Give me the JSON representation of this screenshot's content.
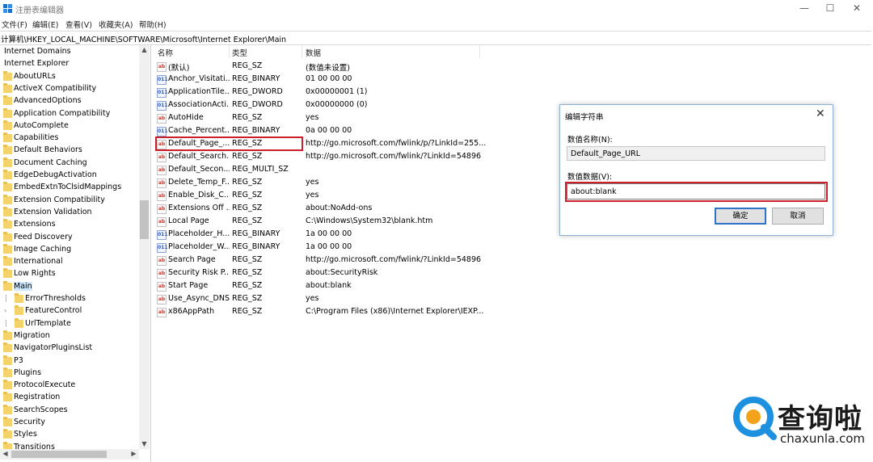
{
  "window": {
    "title": "注册表编辑器",
    "controls": {
      "minimize": "—",
      "maximize": "☐",
      "close": "✕"
    }
  },
  "menu": [
    "文件(F)",
    "编辑(E)",
    "查看(V)",
    "收藏夹(A)",
    "帮助(H)"
  ],
  "address": "计算机\\HKEY_LOCAL_MACHINE\\SOFTWARE\\Microsoft\\Internet Explorer\\Main",
  "tree": {
    "items": [
      {
        "label": "Internet Domains",
        "level": 0,
        "folder": false
      },
      {
        "label": "Internet Explorer",
        "level": 0,
        "folder": false
      },
      {
        "label": "AboutURLs",
        "level": 1,
        "folder": true
      },
      {
        "label": "ActiveX Compatibility",
        "level": 1,
        "folder": true
      },
      {
        "label": "AdvancedOptions",
        "level": 1,
        "folder": true
      },
      {
        "label": "Application Compatibility",
        "level": 1,
        "folder": true
      },
      {
        "label": "AutoComplete",
        "level": 1,
        "folder": true
      },
      {
        "label": "Capabilities",
        "level": 1,
        "folder": true
      },
      {
        "label": "Default Behaviors",
        "level": 1,
        "folder": true
      },
      {
        "label": "Document Caching",
        "level": 1,
        "folder": true
      },
      {
        "label": "EdgeDebugActivation",
        "level": 1,
        "folder": true
      },
      {
        "label": "EmbedExtnToClsidMappings",
        "level": 1,
        "folder": true
      },
      {
        "label": "Extension Compatibility",
        "level": 1,
        "folder": true
      },
      {
        "label": "Extension Validation",
        "level": 1,
        "folder": true
      },
      {
        "label": "Extensions",
        "level": 1,
        "folder": true
      },
      {
        "label": "Feed Discovery",
        "level": 1,
        "folder": true
      },
      {
        "label": "Image Caching",
        "level": 1,
        "folder": true
      },
      {
        "label": "International",
        "level": 1,
        "folder": true
      },
      {
        "label": "Low Rights",
        "level": 1,
        "folder": true
      },
      {
        "label": "Main",
        "level": 1,
        "folder": true,
        "selected": true
      },
      {
        "label": "ErrorThresholds",
        "level": 2,
        "folder": true
      },
      {
        "label": "FeatureControl",
        "level": 2,
        "folder": true,
        "expandable": true
      },
      {
        "label": "UrlTemplate",
        "level": 2,
        "folder": true
      },
      {
        "label": "Migration",
        "level": 1,
        "folder": true
      },
      {
        "label": "NavigatorPluginsList",
        "level": 1,
        "folder": true
      },
      {
        "label": "P3",
        "level": 1,
        "folder": true
      },
      {
        "label": "Plugins",
        "level": 1,
        "folder": true
      },
      {
        "label": "ProtocolExecute",
        "level": 1,
        "folder": true
      },
      {
        "label": "Registration",
        "level": 1,
        "folder": true
      },
      {
        "label": "SearchScopes",
        "level": 1,
        "folder": true
      },
      {
        "label": "Security",
        "level": 1,
        "folder": true
      },
      {
        "label": "Styles",
        "level": 1,
        "folder": true
      },
      {
        "label": "Transitions",
        "level": 1,
        "folder": true
      }
    ]
  },
  "list": {
    "columns": [
      "名称",
      "类型",
      "数据"
    ],
    "rows": [
      {
        "name": "(默认)",
        "type": "REG_SZ",
        "data": "(数值未设置)",
        "icon": "sz"
      },
      {
        "name": "Anchor_Visitati...",
        "type": "REG_BINARY",
        "data": "01 00 00 00",
        "icon": "bin"
      },
      {
        "name": "ApplicationTile...",
        "type": "REG_DWORD",
        "data": "0x00000001 (1)",
        "icon": "bin"
      },
      {
        "name": "AssociationActi...",
        "type": "REG_DWORD",
        "data": "0x00000000 (0)",
        "icon": "bin"
      },
      {
        "name": "AutoHide",
        "type": "REG_SZ",
        "data": "yes",
        "icon": "sz"
      },
      {
        "name": "Cache_Percent...",
        "type": "REG_BINARY",
        "data": "0a 00 00 00",
        "icon": "bin"
      },
      {
        "name": "Default_Page_...",
        "type": "REG_SZ",
        "data": "http://go.microsoft.com/fwlink/p/?LinkId=255...",
        "icon": "sz"
      },
      {
        "name": "Default_Search...",
        "type": "REG_SZ",
        "data": "http://go.microsoft.com/fwlink/?LinkId=54896",
        "icon": "sz"
      },
      {
        "name": "Default_Secon...",
        "type": "REG_MULTI_SZ",
        "data": "",
        "icon": "sz"
      },
      {
        "name": "Delete_Temp_F...",
        "type": "REG_SZ",
        "data": "yes",
        "icon": "sz"
      },
      {
        "name": "Enable_Disk_C...",
        "type": "REG_SZ",
        "data": "yes",
        "icon": "sz"
      },
      {
        "name": "Extensions Off ...",
        "type": "REG_SZ",
        "data": "about:NoAdd-ons",
        "icon": "sz"
      },
      {
        "name": "Local Page",
        "type": "REG_SZ",
        "data": "C:\\Windows\\System32\\blank.htm",
        "icon": "sz"
      },
      {
        "name": "Placeholder_H...",
        "type": "REG_BINARY",
        "data": "1a 00 00 00",
        "icon": "bin"
      },
      {
        "name": "Placeholder_W...",
        "type": "REG_BINARY",
        "data": "1a 00 00 00",
        "icon": "bin"
      },
      {
        "name": "Search Page",
        "type": "REG_SZ",
        "data": "http://go.microsoft.com/fwlink/?LinkId=54896",
        "icon": "sz"
      },
      {
        "name": "Security Risk P...",
        "type": "REG_SZ",
        "data": "about:SecurityRisk",
        "icon": "sz"
      },
      {
        "name": "Start Page",
        "type": "REG_SZ",
        "data": "about:blank",
        "icon": "sz"
      },
      {
        "name": "Use_Async_DNS",
        "type": "REG_SZ",
        "data": "yes",
        "icon": "sz"
      },
      {
        "name": "x86AppPath",
        "type": "REG_SZ",
        "data": "C:\\Program Files (x86)\\Internet Explorer\\IEXP...",
        "icon": "sz"
      }
    ]
  },
  "dialog": {
    "title": "编辑字符串",
    "name_label": "数值名称(N):",
    "name_value": "Default_Page_URL",
    "data_label": "数值数据(V):",
    "data_value": "about:blank",
    "ok": "确定",
    "cancel": "取消"
  },
  "watermark": {
    "title": "查询啦",
    "url": "chaxunla.com"
  },
  "colors": {
    "highlight": "#cc1f2d",
    "selection": "#cde8ff",
    "folder": "#f3d36a",
    "watermark_blue": "#1e90e0"
  }
}
